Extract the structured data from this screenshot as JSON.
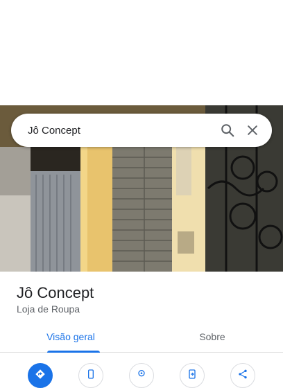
{
  "search": {
    "query": "Jô Concept"
  },
  "place": {
    "name": "Jô Concept",
    "category": "Loja de Roupa"
  },
  "tabs": [
    {
      "label": "Visão geral",
      "active": true
    },
    {
      "label": "Sobre",
      "active": false
    }
  ],
  "actions": [
    {
      "icon": "directions-icon"
    },
    {
      "icon": "call-icon"
    },
    {
      "icon": "save-icon"
    },
    {
      "icon": "send-to-phone-icon"
    },
    {
      "icon": "share-icon"
    }
  ],
  "colors": {
    "accent": "#1a73e8",
    "text": "#202124",
    "secondary": "#5f6368"
  }
}
